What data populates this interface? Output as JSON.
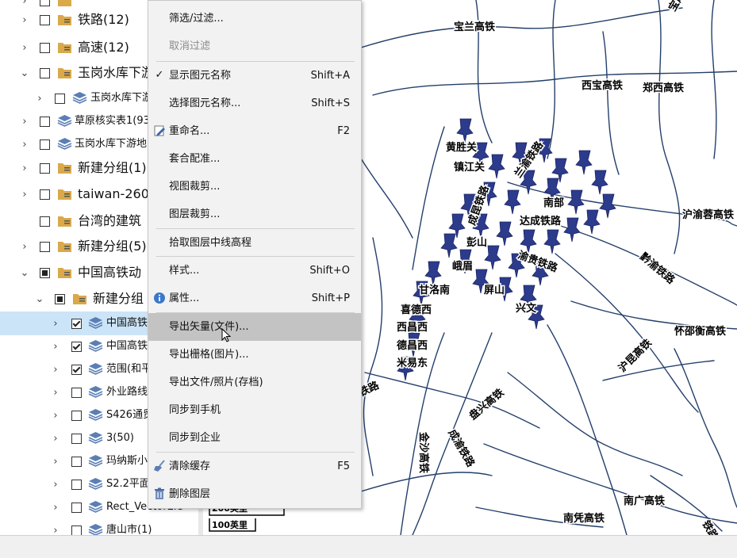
{
  "tree": {
    "rows": [
      {
        "label": "铁路(12)"
      },
      {
        "label": "高速(12)"
      },
      {
        "label": "玉岗水库下游"
      },
      {
        "label": "玉岗水库下游"
      },
      {
        "label": "草原核实表1(93"
      },
      {
        "label": "玉岗水库下游地"
      },
      {
        "label": "新建分组(1)"
      },
      {
        "label": "taiwan-260"
      },
      {
        "label": "台湾的建筑"
      },
      {
        "label": "新建分组(5)"
      },
      {
        "label": "中国高铁动"
      },
      {
        "label": "新建分组"
      },
      {
        "label": "中国高铁"
      },
      {
        "label": "中国高铁"
      },
      {
        "label": "范围(和平"
      },
      {
        "label": "外业路线"
      },
      {
        "label": "S426通贸"
      },
      {
        "label": "3(50)"
      },
      {
        "label": "玛纳斯小"
      },
      {
        "label": "S2.2平面"
      },
      {
        "label": "Rect_VectorEle"
      },
      {
        "label": "唐山市(1)"
      }
    ]
  },
  "menu": {
    "items": [
      {
        "label": "筛选/过滤...",
        "shortcut": ""
      },
      {
        "label": "取消过滤",
        "shortcut": ""
      },
      {
        "label": "显示图元名称",
        "shortcut": "Shift+A"
      },
      {
        "label": "选择图元名称...",
        "shortcut": "Shift+S"
      },
      {
        "label": "重命名...",
        "shortcut": "F2"
      },
      {
        "label": "套合配准...",
        "shortcut": ""
      },
      {
        "label": "视图裁剪...",
        "shortcut": ""
      },
      {
        "label": "图层裁剪...",
        "shortcut": ""
      },
      {
        "label": "拾取图层中线高程",
        "shortcut": ""
      },
      {
        "label": "样式...",
        "shortcut": "Shift+O"
      },
      {
        "label": "属性...",
        "shortcut": "Shift+P"
      },
      {
        "label": "导出矢量(文件)...",
        "shortcut": ""
      },
      {
        "label": "导出栅格(图片)...",
        "shortcut": ""
      },
      {
        "label": "导出文件/照片(存档)",
        "shortcut": ""
      },
      {
        "label": "同步到手机",
        "shortcut": ""
      },
      {
        "label": "同步到企业",
        "shortcut": ""
      },
      {
        "label": "清除缓存",
        "shortcut": "F5"
      },
      {
        "label": "删除图层",
        "shortcut": ""
      }
    ]
  },
  "map": {
    "labels": {
      "l1": "宝兰高铁",
      "l2": "西宝高铁",
      "l3": "郑西高铁",
      "l4": "黄胜关",
      "l5": "镇江关",
      "l6": "南部",
      "l7": "达成铁路",
      "l8": "彭山",
      "l9": "峨眉",
      "l10": "甘洛南",
      "l11": "喜德西",
      "l12": "西昌西",
      "l13": "德昌西",
      "l14": "米易东",
      "l15": "沪渝蓉高铁",
      "l16": "黔渝铁路",
      "l17": "怀邵衡高铁",
      "l18": "沪昆高铁",
      "l19": "盘兴高铁",
      "l20": "南广高铁",
      "l21": "南凭高铁",
      "l22": "铁路",
      "l23": "铁路",
      "l24": "屏山",
      "l25": "兴文",
      "l26": "金沙高铁",
      "l27": "成渝铁路",
      "l28": "宝成铁路",
      "l29": "兰渝铁路",
      "l30": "成昆铁路",
      "l31": "渝贵铁路"
    },
    "scale": {
      "s1": "200英里",
      "s2": "100英里"
    }
  },
  "colors": {
    "route": "#243f6b",
    "pin": "#2c3b8c",
    "highlight": "#c3c3c3",
    "selected_row": "#cce4f7",
    "annotation": "#f04a4a"
  }
}
